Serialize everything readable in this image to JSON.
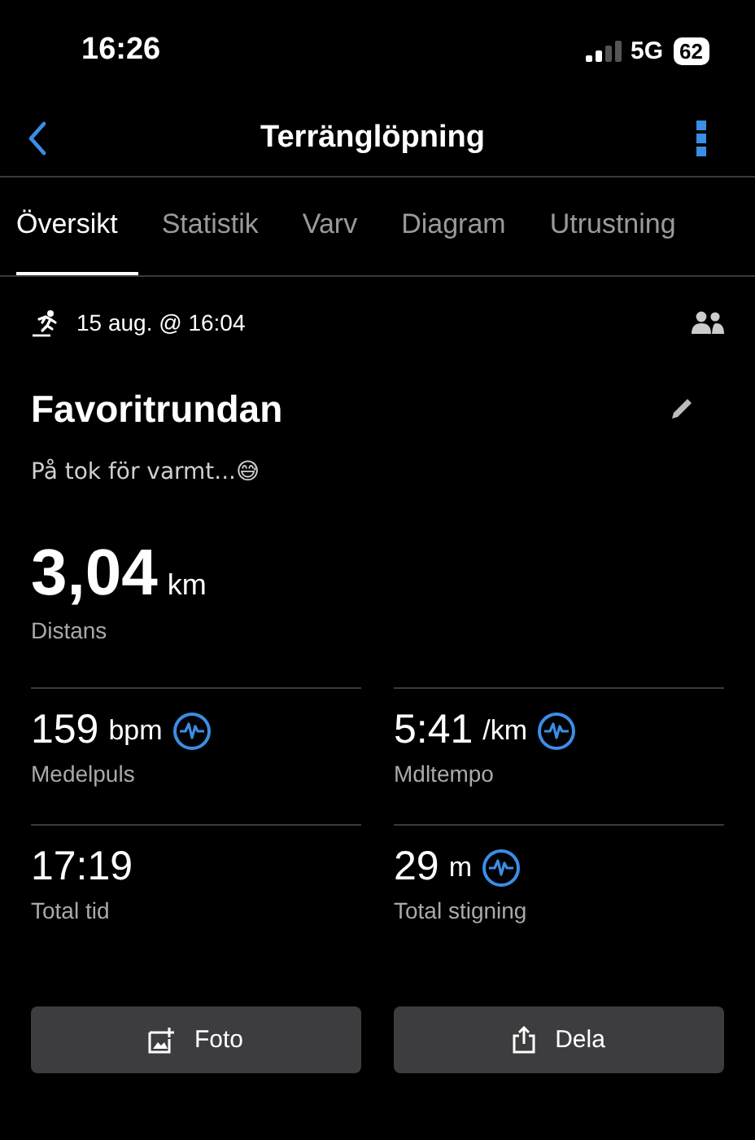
{
  "status_bar": {
    "time": "16:26",
    "network": "5G",
    "battery": "62"
  },
  "nav": {
    "title": "Terränglöpning"
  },
  "tabs": [
    {
      "label": "Översikt",
      "selected": true
    },
    {
      "label": "Statistik",
      "selected": false
    },
    {
      "label": "Varv",
      "selected": false
    },
    {
      "label": "Diagram",
      "selected": false
    },
    {
      "label": "Utrustning",
      "selected": false
    }
  ],
  "activity": {
    "date": "15 aug. @ 16:04",
    "name": "Favoritrundan",
    "note": "På tok för varmt...😅",
    "distance": {
      "value": "3,04",
      "unit": "km",
      "label": "Distans"
    }
  },
  "metrics": [
    {
      "value": "159",
      "unit": "bpm",
      "label": "Medelpuls",
      "has_chart": true
    },
    {
      "value": "5:41",
      "unit": "/km",
      "label": "Mdltempo",
      "has_chart": true
    },
    {
      "value": "17:19",
      "label": "Total tid",
      "has_chart": false
    },
    {
      "value": "29",
      "unit": "m",
      "label": "Total stigning",
      "has_chart": true
    }
  ],
  "buttons": [
    {
      "kind": "photo",
      "label": "Foto"
    },
    {
      "kind": "share",
      "label": "Dela"
    }
  ]
}
